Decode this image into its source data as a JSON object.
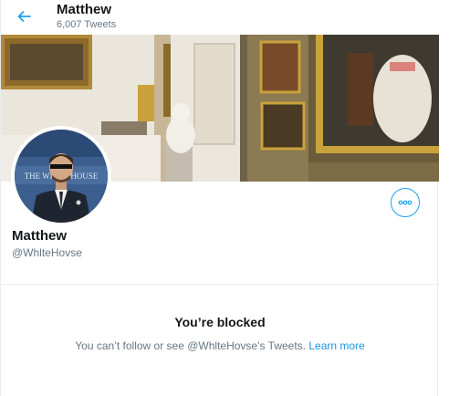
{
  "header": {
    "name": "Matthew",
    "tweet_count": "6,007 Tweets",
    "back_icon": "arrow-left-icon"
  },
  "profile": {
    "name": "Matthew",
    "handle": "@WhlteHovse",
    "more_icon": "more-horizontal-icon",
    "avatar_sign_text": "THE WHITE HOUSE"
  },
  "blocked": {
    "title": "You’re blocked",
    "message": "You can’t follow or see @WhlteHovse’s Tweets.",
    "learn_more": "Learn more"
  },
  "colors": {
    "accent": "#1da1f2",
    "link": "#1b95e0",
    "secondary_text": "#657786",
    "primary_text": "#14171a",
    "divider": "#e6ecf0"
  }
}
